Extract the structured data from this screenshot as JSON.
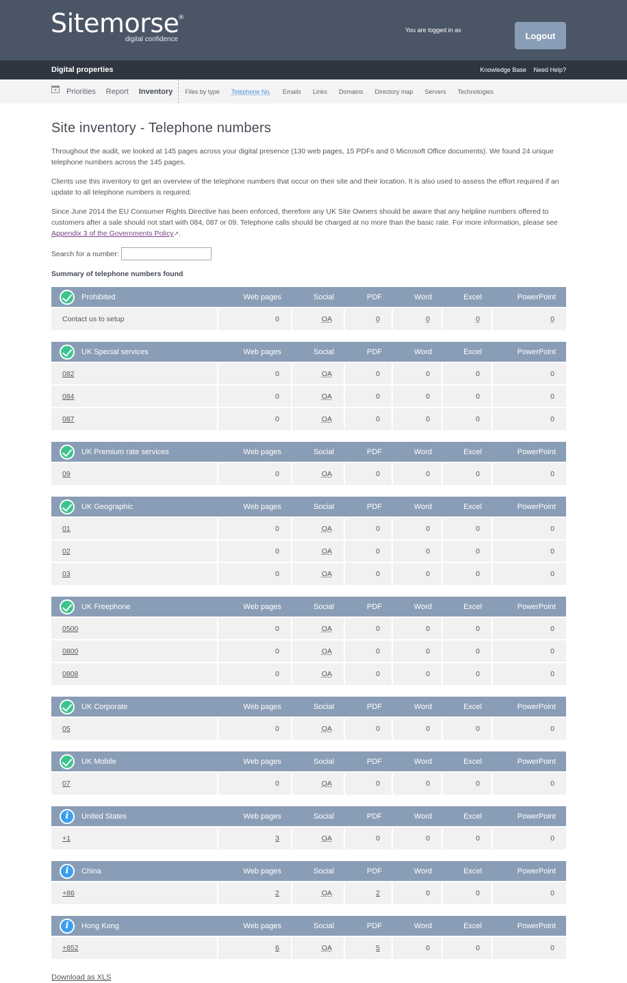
{
  "header": {
    "logo_text": "Sitemorse",
    "logo_reg": "®",
    "logo_tagline": "digital confidence",
    "logged_in_text": "You are logged in as",
    "logout_label": "Logout"
  },
  "subbar": {
    "title": "Digital properties",
    "links": [
      "Knowledge Base",
      "Need Help?"
    ]
  },
  "nav": {
    "main": [
      {
        "label": "Priorities",
        "active": false
      },
      {
        "label": "Report",
        "active": false
      },
      {
        "label": "Inventory",
        "active": true
      }
    ],
    "sub": [
      {
        "label": "Files by type",
        "active": false
      },
      {
        "label": "Telephone No.",
        "active": true
      },
      {
        "label": "Emails",
        "active": false
      },
      {
        "label": "Links",
        "active": false
      },
      {
        "label": "Domains",
        "active": false
      },
      {
        "label": "Directory map",
        "active": false
      },
      {
        "label": "Servers",
        "active": false
      },
      {
        "label": "Technologies",
        "active": false
      }
    ]
  },
  "page": {
    "title": "Site inventory - Telephone numbers",
    "para1": "Throughout the audit, we looked at 145 pages across your digital presence (130 web pages, 15 PDFs and 0 Microsoft Office documents). We found 24 unique telephone numbers across the 145 pages.",
    "para2": "Clients use this inventory to get an overview of the telephone numbers that occur on their site and their location. It is also used to assess the effort required if an update to all telephone numbers is required.",
    "para3_before": "Since June 2014 the EU Consumer Rights Directive has been enforced, therefore any UK Site Owners should be aware that any helpline numbers offered to customers after a sale should not start with 084, 087 or 09. Telephone calls should be charged at no more than the basic rate. For more information, please see ",
    "para3_link": "Appendix 3 of the Governments Policy",
    "para3_after": ".",
    "search_label": "Search for a number:",
    "search_value": "",
    "summary_title": "Summary of telephone numbers found",
    "download_label": "Download as XLS"
  },
  "columns": [
    "Web pages",
    "Social",
    "PDF",
    "Word",
    "Excel",
    "PowerPoint"
  ],
  "groups": [
    {
      "name": "Prohibited",
      "icon": "check",
      "rows": [
        {
          "number": "Contact us to setup",
          "link": false,
          "values": [
            "0",
            "OA",
            "0",
            "0",
            "0",
            "0"
          ],
          "linked": [
            false,
            true,
            true,
            true,
            true,
            true
          ]
        }
      ]
    },
    {
      "name": "UK Special services",
      "icon": "check",
      "rows": [
        {
          "number": "082",
          "link": true,
          "values": [
            "0",
            "OA",
            "0",
            "0",
            "0",
            "0"
          ],
          "linked": [
            false,
            true,
            false,
            false,
            false,
            false
          ]
        },
        {
          "number": "084",
          "link": true,
          "values": [
            "0",
            "OA",
            "0",
            "0",
            "0",
            "0"
          ],
          "linked": [
            false,
            true,
            false,
            false,
            false,
            false
          ]
        },
        {
          "number": "087",
          "link": true,
          "values": [
            "0",
            "OA",
            "0",
            "0",
            "0",
            "0"
          ],
          "linked": [
            false,
            true,
            false,
            false,
            false,
            false
          ]
        }
      ]
    },
    {
      "name": "UK Premium rate services",
      "icon": "check",
      "rows": [
        {
          "number": "09",
          "link": true,
          "values": [
            "0",
            "OA",
            "0",
            "0",
            "0",
            "0"
          ],
          "linked": [
            false,
            true,
            false,
            false,
            false,
            false
          ]
        }
      ]
    },
    {
      "name": "UK Geographic",
      "icon": "check",
      "rows": [
        {
          "number": "01",
          "link": true,
          "values": [
            "0",
            "OA",
            "0",
            "0",
            "0",
            "0"
          ],
          "linked": [
            false,
            true,
            false,
            false,
            false,
            false
          ]
        },
        {
          "number": "02",
          "link": true,
          "values": [
            "0",
            "OA",
            "0",
            "0",
            "0",
            "0"
          ],
          "linked": [
            false,
            true,
            false,
            false,
            false,
            false
          ]
        },
        {
          "number": "03",
          "link": true,
          "values": [
            "0",
            "OA",
            "0",
            "0",
            "0",
            "0"
          ],
          "linked": [
            false,
            true,
            false,
            false,
            false,
            false
          ]
        }
      ]
    },
    {
      "name": "UK Freephone",
      "icon": "check",
      "rows": [
        {
          "number": "0500",
          "link": true,
          "values": [
            "0",
            "OA",
            "0",
            "0",
            "0",
            "0"
          ],
          "linked": [
            false,
            true,
            false,
            false,
            false,
            false
          ]
        },
        {
          "number": "0800",
          "link": true,
          "values": [
            "0",
            "OA",
            "0",
            "0",
            "0",
            "0"
          ],
          "linked": [
            false,
            true,
            false,
            false,
            false,
            false
          ]
        },
        {
          "number": "0808",
          "link": true,
          "values": [
            "0",
            "OA",
            "0",
            "0",
            "0",
            "0"
          ],
          "linked": [
            false,
            true,
            false,
            false,
            false,
            false
          ]
        }
      ]
    },
    {
      "name": "UK Corporate",
      "icon": "check",
      "rows": [
        {
          "number": "05",
          "link": true,
          "values": [
            "0",
            "OA",
            "0",
            "0",
            "0",
            "0"
          ],
          "linked": [
            false,
            true,
            false,
            false,
            false,
            false
          ]
        }
      ]
    },
    {
      "name": "UK Mobile",
      "icon": "check",
      "rows": [
        {
          "number": "07",
          "link": true,
          "values": [
            "0",
            "OA",
            "0",
            "0",
            "0",
            "0"
          ],
          "linked": [
            false,
            true,
            false,
            false,
            false,
            false
          ]
        }
      ]
    },
    {
      "name": "United States",
      "icon": "info",
      "rows": [
        {
          "number": "+1",
          "link": true,
          "values": [
            "3",
            "OA",
            "0",
            "0",
            "0",
            "0"
          ],
          "linked": [
            true,
            true,
            false,
            false,
            false,
            false
          ]
        }
      ]
    },
    {
      "name": "China",
      "icon": "info",
      "rows": [
        {
          "number": "+86",
          "link": true,
          "values": [
            "2",
            "OA",
            "2",
            "0",
            "0",
            "0"
          ],
          "linked": [
            true,
            true,
            true,
            false,
            false,
            false
          ]
        }
      ]
    },
    {
      "name": "Hong Kong",
      "icon": "info",
      "rows": [
        {
          "number": "+852",
          "link": true,
          "values": [
            "6",
            "OA",
            "5",
            "0",
            "0",
            "0"
          ],
          "linked": [
            true,
            true,
            true,
            false,
            false,
            false
          ]
        }
      ]
    }
  ],
  "colors": {
    "topbar": "#4a5566",
    "subbar": "#2f3642",
    "table_header": "#8a9db6",
    "check_icon": "#3cc48e",
    "info_icon": "#3a9ff0",
    "active_subnav": "#4a90e2"
  }
}
